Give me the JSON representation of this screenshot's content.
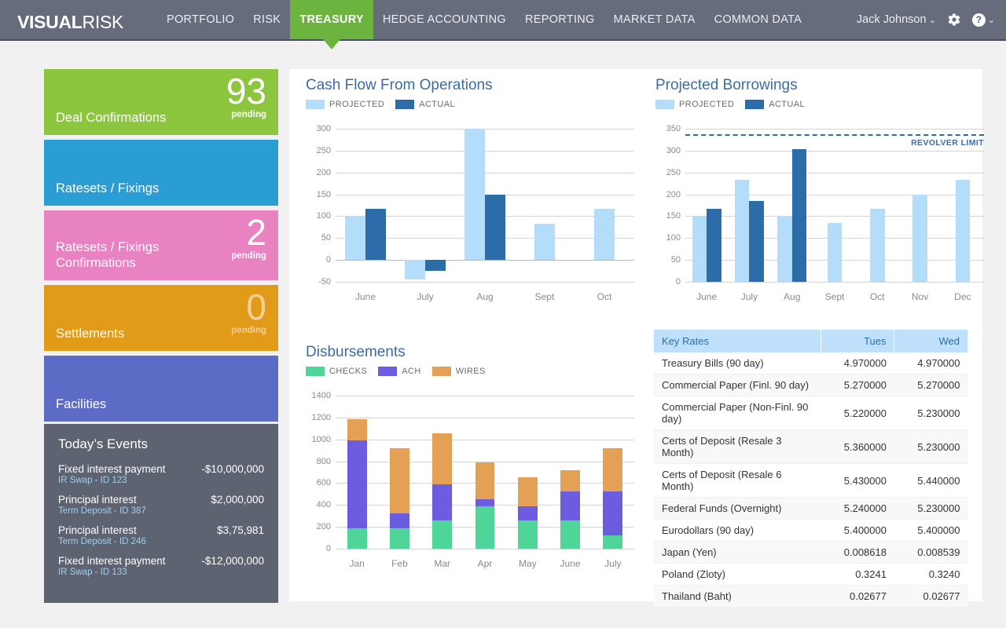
{
  "header": {
    "logo_bold": "VISUAL",
    "logo_light": "RISK",
    "nav": [
      {
        "label": "PORTFOLIO",
        "active": false
      },
      {
        "label": "RISK",
        "active": false
      },
      {
        "label": "TREASURY",
        "active": true
      },
      {
        "label": "HEDGE ACCOUNTING",
        "active": false
      },
      {
        "label": "REPORTING",
        "active": false
      },
      {
        "label": "MARKET DATA",
        "active": false
      },
      {
        "label": "COMMON DATA",
        "active": false
      }
    ],
    "user_name": "Jack Johnson",
    "user_caret": "⌄",
    "help_glyph": "?",
    "help_caret": "⌄",
    "accent_green": "#6cb33f",
    "bar_color": "#666c7c"
  },
  "tiles": [
    {
      "label": "Deal Confirmations",
      "count": "93",
      "sub": "pending",
      "color": "#8cc63e",
      "dim": false
    },
    {
      "label": "Ratesets / Fixings",
      "count": "",
      "sub": "",
      "color": "#2a9ed4",
      "dim": false
    },
    {
      "label": "Ratesets / Fixings\nConfirmations",
      "count": "2",
      "sub": "pending",
      "color": "#e882c0",
      "dim": false
    },
    {
      "label": "Settlements",
      "count": "0",
      "sub": "pending",
      "color": "#e29a19",
      "dim": true
    },
    {
      "label": "Facilities",
      "count": "",
      "sub": "",
      "color": "#5c6bc6",
      "dim": false
    }
  ],
  "events": {
    "title": "Today’s Events",
    "items": [
      {
        "title": "Fixed interest payment",
        "amount": "-$10,000,000",
        "sub": "IR Swap - ID 123"
      },
      {
        "title": "Principal interest",
        "amount": "$2,000,000",
        "sub": "Term Deposit - ID 387"
      },
      {
        "title": "Principal interest",
        "amount": "$3,75,981",
        "sub": "Term Deposit - ID 246"
      },
      {
        "title": "Fixed interest payment",
        "amount": "-$12,000,000",
        "sub": "IR Swap - ID 133"
      }
    ]
  },
  "chart_data": [
    {
      "id": "cash_flow",
      "type": "bar",
      "title": "Cash Flow From Operations",
      "categories": [
        "June",
        "July",
        "Aug",
        "Sept",
        "Oct"
      ],
      "series": [
        {
          "name": "PROJECTED",
          "color": "#b4dcfb",
          "values": [
            100,
            -45,
            300,
            83,
            117
          ]
        },
        {
          "name": "ACTUAL",
          "color": "#2c6ca8",
          "values": [
            117,
            -25,
            150,
            null,
            null
          ]
        }
      ],
      "yticks": [
        300,
        250,
        200,
        150,
        100,
        50,
        0,
        -50
      ],
      "ylim": [
        -50,
        300
      ],
      "xlabel": "",
      "ylabel": "",
      "grid": true,
      "legend_position": "top-left"
    },
    {
      "id": "projected_borrowings",
      "type": "bar",
      "title": "Projected Borrowings",
      "categories": [
        "June",
        "July",
        "Aug",
        "Sept",
        "Oct",
        "Nov",
        "Dec"
      ],
      "series": [
        {
          "name": "PROJECTED",
          "color": "#b4dcfb",
          "values": [
            151,
            234,
            151,
            134,
            167,
            200,
            234
          ]
        },
        {
          "name": "ACTUAL",
          "color": "#2c6ca8",
          "values": [
            167,
            184,
            304,
            null,
            null,
            null,
            null
          ]
        }
      ],
      "yticks": [
        350,
        300,
        250,
        200,
        150,
        100,
        50,
        0
      ],
      "ylim": [
        0,
        350
      ],
      "annotations": [
        {
          "label": "REVOLVER LIMIT",
          "value": 337,
          "style": "dashed",
          "color": "#2e6ca4"
        }
      ],
      "xlabel": "",
      "ylabel": "",
      "grid": true,
      "legend_position": "top-left"
    },
    {
      "id": "disbursements",
      "type": "bar",
      "stacked": true,
      "title": "Disbursements",
      "categories": [
        "Jan",
        "Feb",
        "Mar",
        "Apr",
        "May",
        "June",
        "July"
      ],
      "series": [
        {
          "name": "CHECKS",
          "color": "#4fd49a",
          "values": [
            190,
            190,
            255,
            390,
            255,
            255,
            125
          ]
        },
        {
          "name": "ACH",
          "color": "#6c5ce0",
          "values": [
            800,
            130,
            335,
            65,
            135,
            270,
            400
          ]
        },
        {
          "name": "WIRES",
          "color": "#e4a055",
          "values": [
            195,
            600,
            465,
            335,
            265,
            195,
            395
          ]
        }
      ],
      "yticks": [
        1400,
        1200,
        1000,
        800,
        600,
        400,
        200,
        0
      ],
      "ylim": [
        0,
        1400
      ],
      "xlabel": "",
      "ylabel": "",
      "grid": true,
      "legend_position": "top-left"
    }
  ],
  "key_rates": {
    "headers": [
      "Key Rates",
      "Tues",
      "Wed"
    ],
    "rows": [
      {
        "name": "Treasury Bills (90 day)",
        "tues": "4.970000",
        "wed": "4.970000"
      },
      {
        "name": "Commercial Paper (Finl. 90 day)",
        "tues": "5.270000",
        "wed": "5.270000"
      },
      {
        "name": "Commercial Paper (Non-Finl. 90 day)",
        "tues": "5.220000",
        "wed": "5.230000"
      },
      {
        "name": "Certs of Deposit (Resale 3 Month)",
        "tues": "5.360000",
        "wed": "5.230000"
      },
      {
        "name": "Certs of Deposit (Resale 6 Month)",
        "tues": "5.430000",
        "wed": "5.440000"
      },
      {
        "name": "Federal Funds (Overnight)",
        "tues": "5.240000",
        "wed": "5.230000"
      },
      {
        "name": "Eurodollars (90 day)",
        "tues": "5.400000",
        "wed": "5.400000"
      },
      {
        "name": "Japan (Yen)",
        "tues": "0.008618",
        "wed": "0.008539"
      },
      {
        "name": "Poland (Zloty)",
        "tues": "0.3241",
        "wed": "0.3240"
      },
      {
        "name": "Thailand (Baht)",
        "tues": "0.02677",
        "wed": "0.02677"
      }
    ]
  }
}
